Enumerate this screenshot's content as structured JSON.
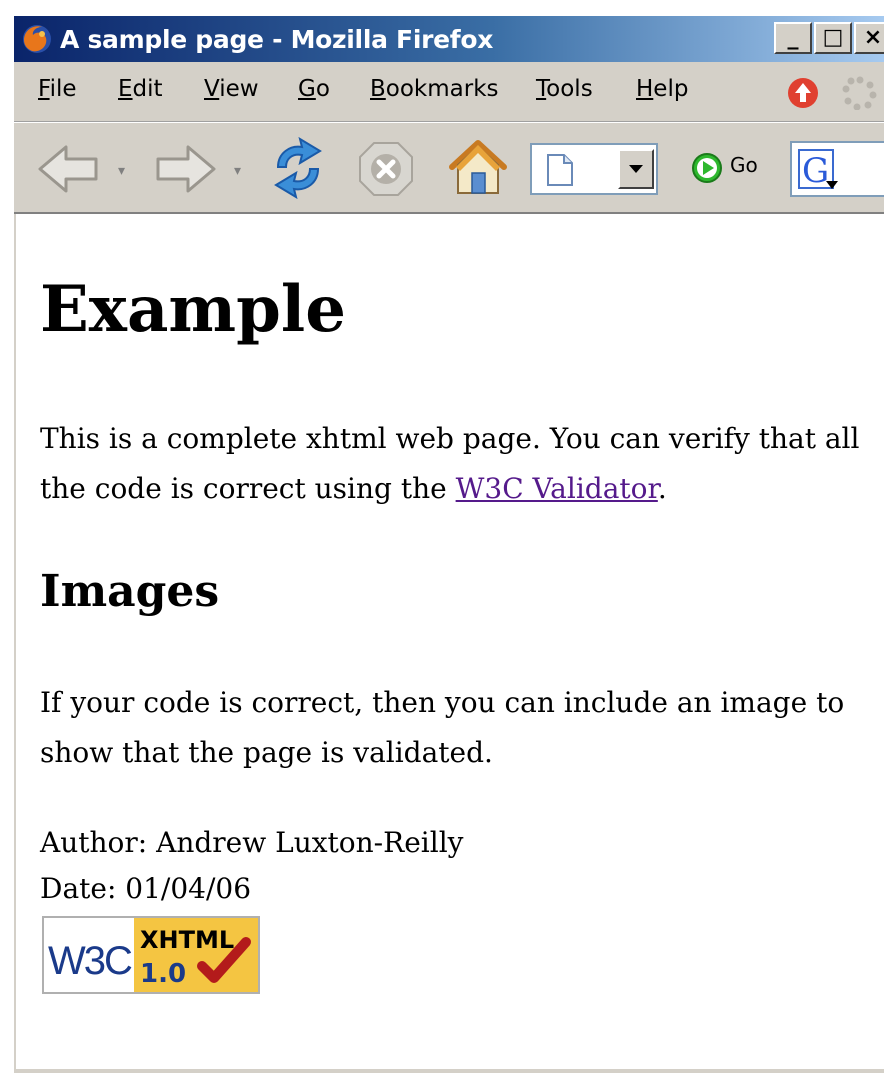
{
  "window": {
    "title": "A sample page - Mozilla Firefox",
    "buttons": {
      "minimize": "_",
      "maximize": "□",
      "close": "×"
    }
  },
  "menubar": {
    "items": [
      {
        "mnemonic": "F",
        "rest": "ile"
      },
      {
        "mnemonic": "E",
        "rest": "dit"
      },
      {
        "mnemonic": "V",
        "rest": "iew"
      },
      {
        "mnemonic": "G",
        "rest": "o"
      },
      {
        "mnemonic": "B",
        "rest": "ookmarks"
      },
      {
        "mnemonic": "T",
        "rest": "ools"
      },
      {
        "mnemonic": "H",
        "rest": "elp"
      }
    ]
  },
  "toolbar": {
    "go_label": "Go",
    "icons": [
      "back-icon",
      "forward-icon",
      "reload-icon",
      "stop-icon",
      "home-icon",
      "page-icon",
      "go-icon",
      "google-search-icon"
    ]
  },
  "page": {
    "heading": "Example",
    "intro_text": "This is a complete xhtml web page. You can verify that all the code is correct using the ",
    "intro_link": "W3C Validator",
    "intro_end": ".",
    "subheading": "Images",
    "images_text": "If your code is correct, then you can include an image to show that the page is validated.",
    "author": "Author: Andrew Luxton-Reilly",
    "date": "Date: 01/04/06",
    "badge": {
      "w3c": "W3C",
      "line1": "XHTML",
      "line2": "1.0"
    }
  },
  "colors": {
    "title_bar_start": "#0a246a",
    "chrome": "#d4d0c8",
    "visited_link": "#551a8b",
    "badge_yellow": "#f4c542",
    "check_red": "#b31b1b"
  }
}
